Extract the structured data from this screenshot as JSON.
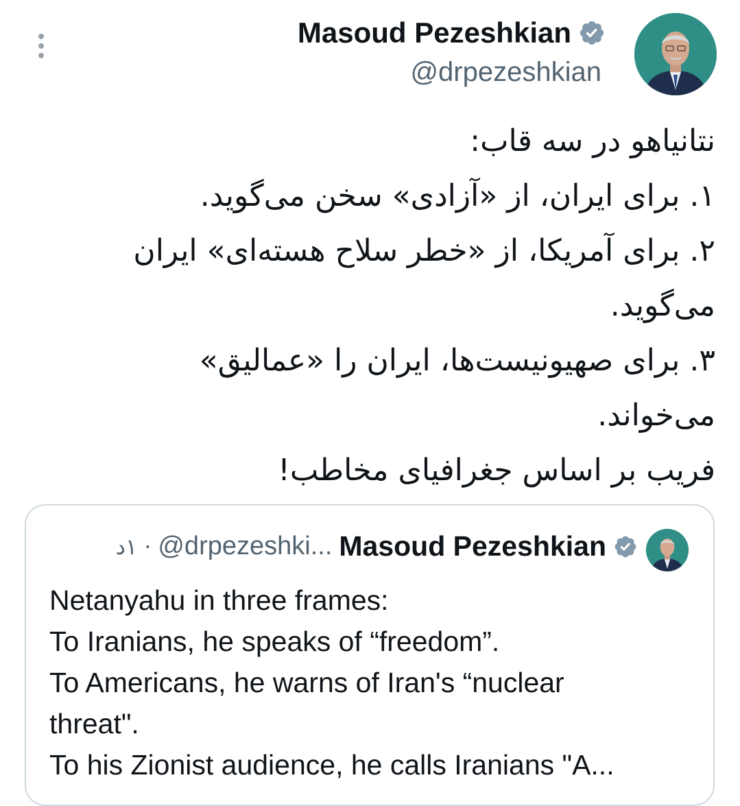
{
  "author": {
    "display_name": "Masoud Pezeshkian",
    "handle": "@drpezeshkian",
    "verified": true
  },
  "tweet": {
    "lines": [
      "نتانیاهو در سه قاب:",
      "۱. برای ایران، از «آزادی» سخن می‌گوید.",
      "۲. برای آمریکا، از «خطر سلاح هسته‌ای» ایران",
      "می‌گوید.",
      "۳. برای صهیونیست‌ها، ایران را «عمالیق»",
      "می‌خواند.",
      "فریب بر اساس جغرافیای مخاطب!"
    ]
  },
  "quote": {
    "display_name": "Masoud Pezeshkian",
    "handle": "@drpezeshki...",
    "separator": "·",
    "time": "۱د",
    "verified": true,
    "lines": [
      "Netanyahu in three frames:",
      "To Iranians, he speaks of “freedom”.",
      "To Americans, he warns of Iran's “nuclear",
      "threat\".",
      "To his Zionist audience, he calls Iranians \"A..."
    ]
  },
  "colors": {
    "text_primary": "#0f1419",
    "text_secondary": "#536471",
    "verified_badge": "#829aab",
    "card_border": "#cfd9de",
    "avatar_bg": "#2f8f86"
  },
  "icons": {
    "more": "more-vertical-icon",
    "verified": "verified-badge-icon"
  }
}
